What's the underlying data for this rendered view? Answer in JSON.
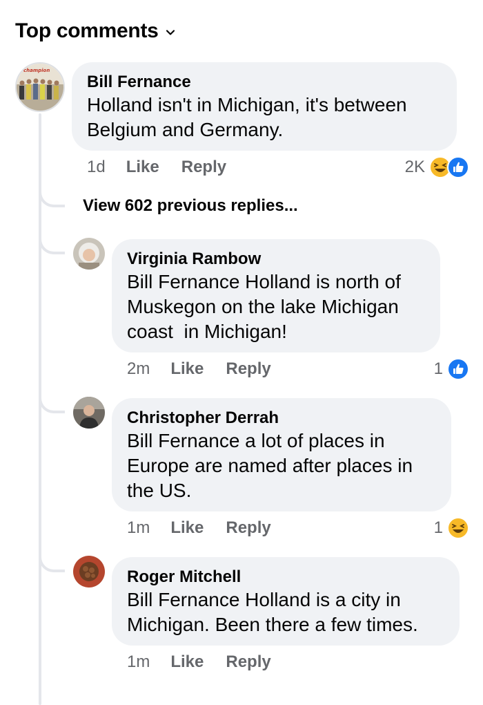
{
  "header": {
    "title": "Top comments"
  },
  "main_comment": {
    "author": "Bill Fernance",
    "text": "Holland isn't in Michigan, it's between\nBelgium and Germany.",
    "time": "1d",
    "like_label": "Like",
    "reply_label": "Reply",
    "reaction_count": "2K",
    "reactions": [
      "haha-icon",
      "like-icon"
    ],
    "avatar_caption": "champion"
  },
  "view_more": {
    "label": "View 602 previous replies..."
  },
  "replies": [
    {
      "author": "Virginia Rambow",
      "text": "Bill Fernance Holland is north of\nMuskegon on the lake Michigan\ncoast  in Michigan!",
      "time": "2m",
      "like_label": "Like",
      "reply_label": "Reply",
      "reaction_count": "1",
      "reactions": [
        "like-icon"
      ]
    },
    {
      "author": "Christopher Derrah",
      "text": "Bill Fernance a lot of places in\nEurope are named after places in\nthe US.",
      "time": "1m",
      "like_label": "Like",
      "reply_label": "Reply",
      "reaction_count": "1",
      "reactions": [
        "haha-icon"
      ]
    },
    {
      "author": "Roger Mitchell",
      "text": "Bill Fernance Holland is a city in\nMichigan. Been there a few times.",
      "time": "1m",
      "like_label": "Like",
      "reply_label": "Reply"
    }
  ],
  "colors": {
    "bubble": "#f0f2f5",
    "meta_text": "#65676b",
    "like_blue": "#1877f2",
    "haha_yellow": "#f7b928"
  }
}
